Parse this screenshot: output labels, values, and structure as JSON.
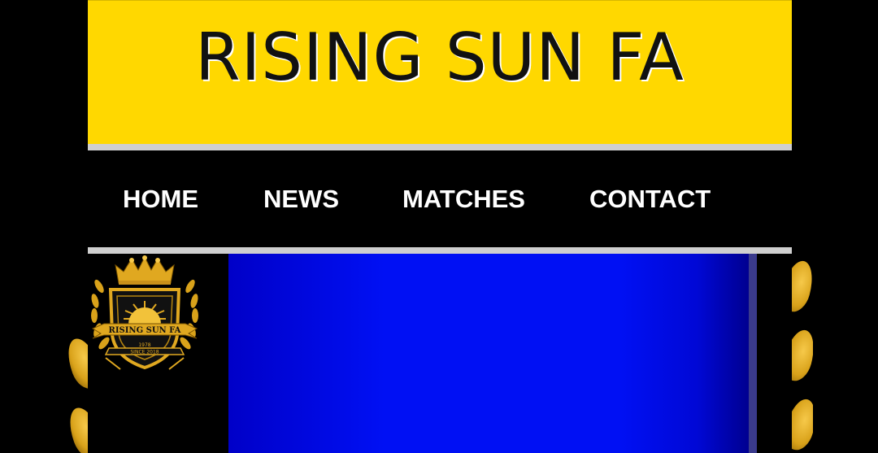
{
  "header": {
    "title": "RISING SUN FA"
  },
  "nav": {
    "items": [
      {
        "label": "HOME"
      },
      {
        "label": "NEWS"
      },
      {
        "label": "MATCHES"
      },
      {
        "label": "CONTACT"
      }
    ]
  },
  "logo": {
    "text": "RISING SUN FA",
    "est": "1978",
    "since": "SINCE 2018"
  },
  "colors": {
    "header_bg": "#ffd800",
    "nav_bg": "#000000",
    "panel_blue": "#0010f4",
    "gold": "#e0a820"
  }
}
